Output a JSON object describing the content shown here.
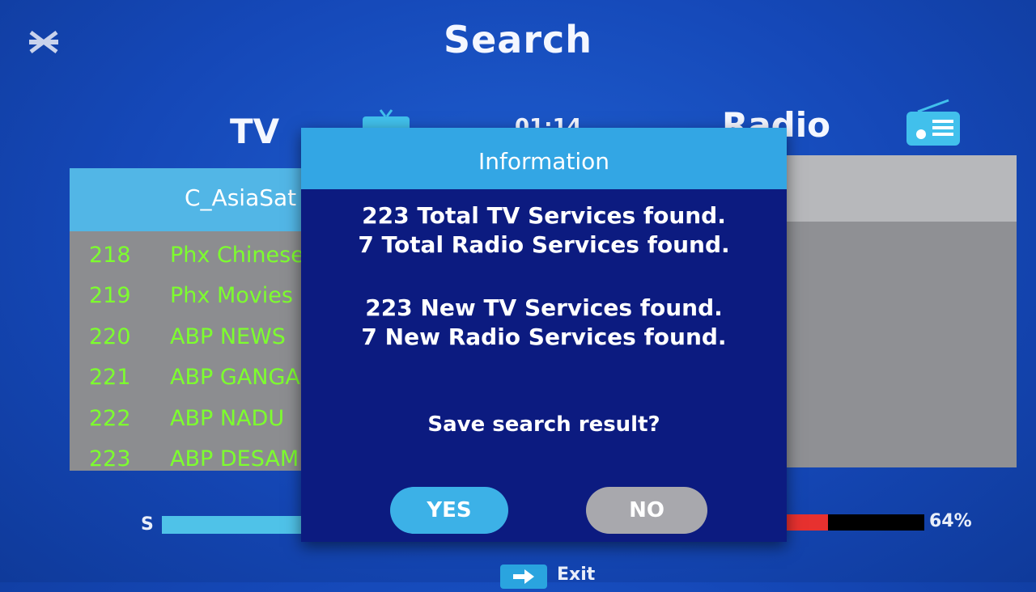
{
  "header": {
    "title": "Search",
    "logo_icon": "app-logo-icon"
  },
  "tv_section": {
    "label": "TV",
    "icon": "tv-icon",
    "satellite": "C_AsiaSat",
    "channels": [
      {
        "number": "218",
        "name": "Phx Chinese"
      },
      {
        "number": "219",
        "name": "Phx Movies"
      },
      {
        "number": "220",
        "name": "ABP NEWS"
      },
      {
        "number": "221",
        "name": "ABP GANGA"
      },
      {
        "number": "222",
        "name": "ABP NADU"
      },
      {
        "number": "223",
        "name": "ABP DESAM"
      }
    ]
  },
  "radio_section": {
    "label": "Radio",
    "icon": "radio-icon"
  },
  "time": "01:14",
  "progress": {
    "signal_label": "S",
    "quality_percent": "64%",
    "quality_value": 0.38
  },
  "footer": {
    "exit_label": "Exit",
    "exit_key_icon": "arrow-right-icon"
  },
  "dialog": {
    "title": "Information",
    "lines": [
      "223 Total TV Services found.",
      "7 Total Radio Services found.",
      "223 New TV Services found.",
      "7 New Radio Services found."
    ],
    "question": "Save search result?",
    "yes_label": "YES",
    "no_label": "NO"
  },
  "colors": {
    "background": "#1548b8",
    "accent": "#33a6e4",
    "dialog": "#0c1b80",
    "channel_text": "#7dff2e",
    "quality": "#e7312f"
  }
}
